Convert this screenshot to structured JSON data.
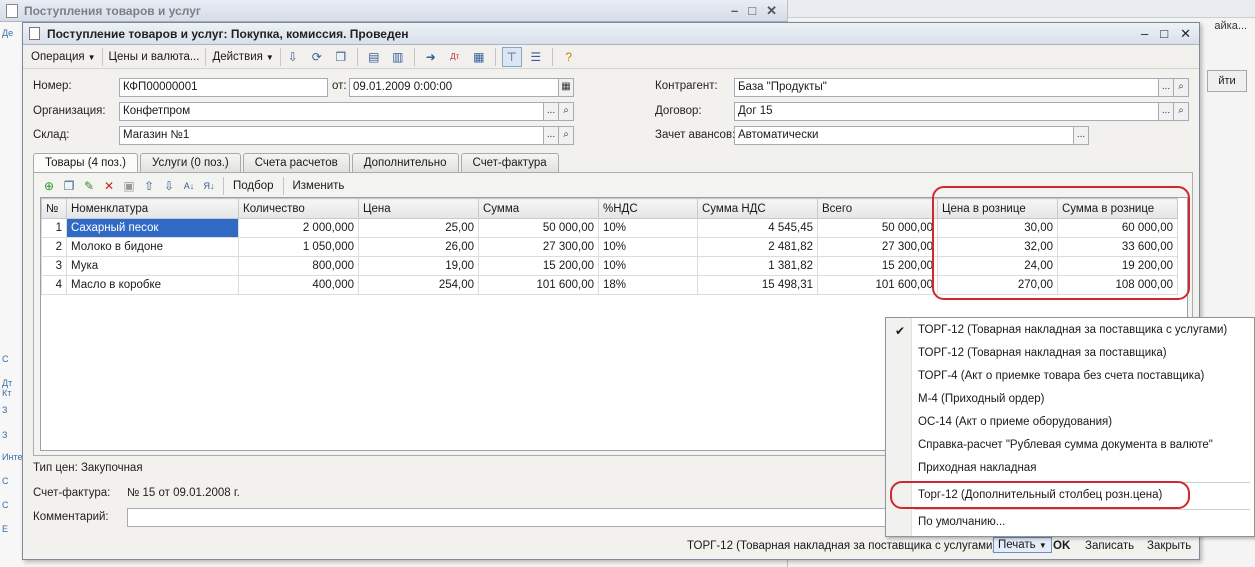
{
  "background": {
    "window_title": "Поступления товаров и услуг",
    "left_letters": [
      "Де"
    ],
    "right_hint": "айка...",
    "right_button": "йти",
    "left_strip": [
      "С",
      "Дт Кт",
      "З",
      "З",
      "Инте",
      "С",
      "С",
      "Е"
    ]
  },
  "dialog": {
    "title": "Поступление товаров и услуг: Покупка, комиссия. Проведен",
    "menu": [
      "Операция",
      "Цены и валюта...",
      "Действия"
    ]
  },
  "form": {
    "number_label": "Номер:",
    "number_value": "КФП00000001",
    "date_label": "от:",
    "date_value": "09.01.2009  0:00:00",
    "org_label": "Организация:",
    "org_value": "Конфетпром",
    "warehouse_label": "Склад:",
    "warehouse_value": "Магазин №1",
    "contractor_label": "Контрагент:",
    "contractor_value": "База \"Продукты\"",
    "contract_label": "Договор:",
    "contract_value": "Дог 15",
    "advance_label": "Зачет авансов:",
    "advance_value": "Автоматически"
  },
  "tabs": [
    "Товары (4 поз.)",
    "Услуги (0 поз.)",
    "Счета расчетов",
    "Дополнительно",
    "Счет-фактура"
  ],
  "panel_toolbar": {
    "pick": "Подбор",
    "change": "Изменить"
  },
  "table": {
    "headers": [
      "№",
      "Номенклатура",
      "Количество",
      "Цена",
      "Сумма",
      "%НДС",
      "Сумма НДС",
      "Всего",
      "Цена в рознице",
      "Сумма в рознице"
    ],
    "rows": [
      [
        "1",
        "Сахарный песок",
        "2 000,000",
        "25,00",
        "50 000,00",
        "10%",
        "4 545,45",
        "50 000,00",
        "30,00",
        "60 000,00"
      ],
      [
        "2",
        "Молоко в бидоне",
        "1 050,000",
        "26,00",
        "27 300,00",
        "10%",
        "2 481,82",
        "27 300,00",
        "32,00",
        "33 600,00"
      ],
      [
        "3",
        "Мука",
        "800,000",
        "19,00",
        "15 200,00",
        "10%",
        "1 381,82",
        "15 200,00",
        "24,00",
        "19 200,00"
      ],
      [
        "4",
        "Масло в коробке",
        "400,000",
        "254,00",
        "101 600,00",
        "18%",
        "15 498,31",
        "101 600,00",
        "270,00",
        "108 000,00"
      ]
    ]
  },
  "bottom": {
    "price_type": "Тип цен: Закупочная",
    "invoice_label": "Счет-фактура:",
    "invoice_value": "№ 15 от 09.01.2008 г.",
    "comment_label": "Комментарий:",
    "comment_value": ""
  },
  "print_menu": {
    "items": [
      "ТОРГ-12 (Товарная накладная за поставщика с услугами)",
      "ТОРГ-12 (Товарная накладная за поставщика)",
      "ТОРГ-4 (Акт о приемке товара без счета поставщика)",
      "М-4 (Приходный ордер)",
      "ОС-14 (Акт о приеме оборудования)",
      "Справка-расчет \"Рублевая сумма документа в валюте\"",
      "Приходная накладная",
      "Торг-12 (Дополнительный столбец розн.цена)",
      "По умолчанию..."
    ],
    "checked_index": 0
  },
  "footer": {
    "default_print": "ТОРГ-12 (Товарная накладная за поставщика с услугами)",
    "print": "Печать",
    "ok": "OK",
    "save": "Записать",
    "close": "Закрыть"
  },
  "colors": {
    "highlight": "#d0282e",
    "selection": "#316ac5"
  }
}
